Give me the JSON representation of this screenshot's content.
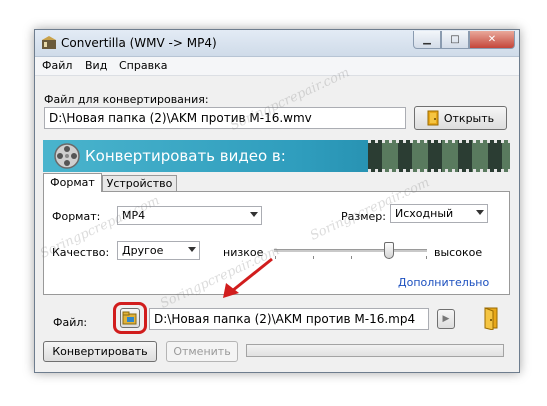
{
  "window": {
    "title": "Convertilla  (WMV -> MP4)"
  },
  "menu": [
    "Файл",
    "Вид",
    "Справка"
  ],
  "source": {
    "label": "Файл для конвертирования:",
    "path": "D:\\Новая папка (2)\\AKM против M-16.wmv",
    "open_button": "Открыть"
  },
  "banner": {
    "text": "Конвертировать видео в:"
  },
  "tabs": [
    {
      "label": "Формат",
      "active": true
    },
    {
      "label": "Устройство",
      "active": false
    }
  ],
  "format_panel": {
    "format_label": "Формат:",
    "format_value": "MP4",
    "size_label": "Размер:",
    "size_value": "Исходный",
    "quality_label": "Качество:",
    "quality_value": "Другое",
    "quality_low": "низкое",
    "quality_high": "высокое",
    "quality_level": 0.75,
    "more_link": "Дополнительно"
  },
  "output": {
    "label": "Файл:",
    "path": "D:\\Новая папка (2)\\AKM против M-16.mp4"
  },
  "actions": {
    "convert": "Конвертировать",
    "cancel": "Отменить",
    "progress": 0
  },
  "watermark": "Soringpcrepair.com",
  "colors": {
    "highlight": "#d11d1d",
    "banner": "#2f9dbd",
    "link": "#1b4fbf"
  }
}
